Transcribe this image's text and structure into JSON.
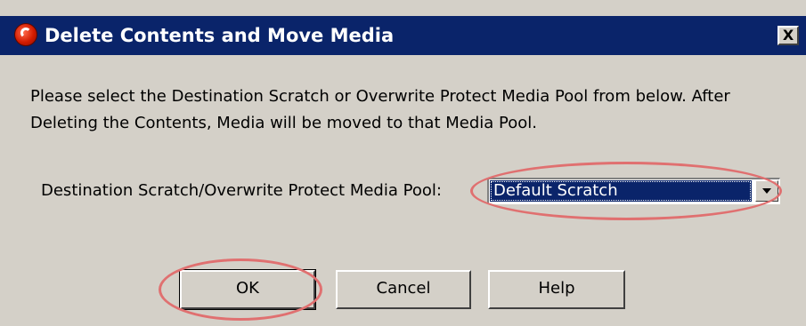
{
  "window": {
    "title": "Delete Contents and Move Media",
    "close_label": "X"
  },
  "message": "Please select the Destination Scratch or Overwrite Protect Media Pool from below. After Deleting the Contents, Media will be moved to that Media Pool.",
  "pool": {
    "label": "Destination Scratch/Overwrite Protect Media Pool:",
    "selected_value": "Default Scratch"
  },
  "buttons": {
    "ok_label": "OK",
    "cancel_label": "Cancel",
    "help_label": "Help"
  },
  "colors": {
    "titlebar": "#0a246a",
    "dialog_background": "#d4d0c8",
    "annotation": "#e07070"
  },
  "icons": {
    "app": "app-logo-icon",
    "close": "close-icon",
    "dropdown": "chevron-down-icon"
  }
}
